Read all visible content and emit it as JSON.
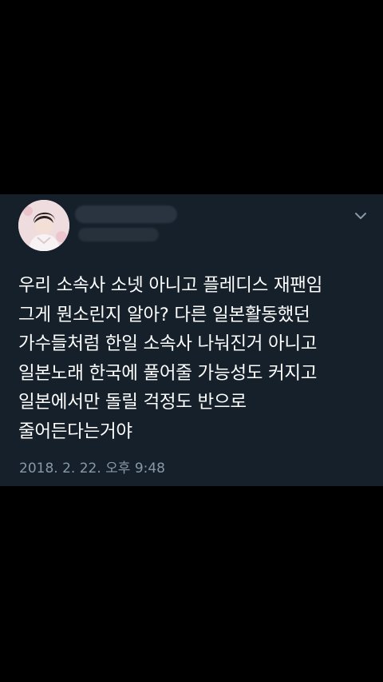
{
  "tweet": {
    "lines": [
      "우리 소속사 소넷 아니고 플레디스 재팬임",
      "그게 뭔소린지 알아? 다른 일본활동했던",
      "가수들처럼 한일 소속사 나눠진거 아니고",
      "일본노래 한국에 풀어줄 가능성도 커지고",
      "일본에서만 돌릴 걱정도 반으로",
      "줄어든다는거야"
    ],
    "timestamp": "2018. 2. 22. 오후 9:48"
  },
  "colors": {
    "background": "#000000",
    "card": "#15202b",
    "text": "#ffffff",
    "muted": "#8899a6"
  },
  "icons": {
    "menu": "chevron-down-icon",
    "avatar": "avatar"
  }
}
